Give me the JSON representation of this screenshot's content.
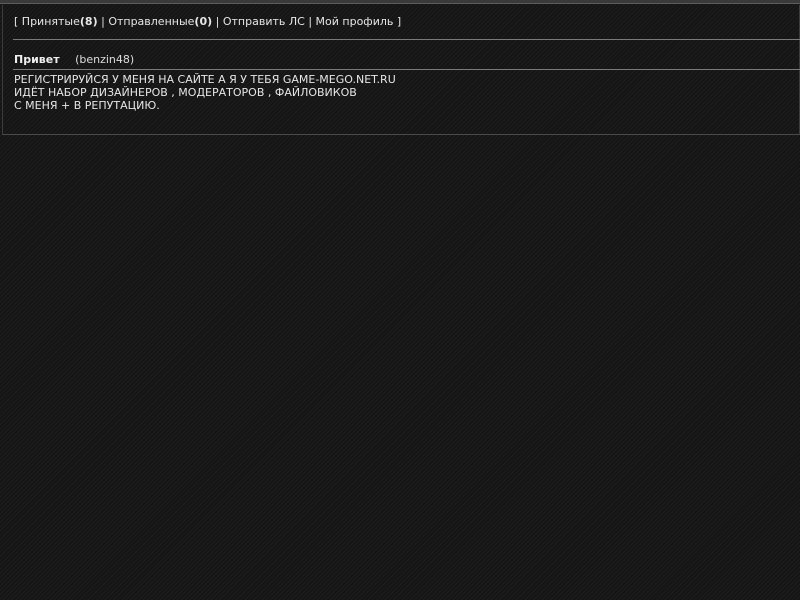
{
  "nav": {
    "open_bracket": "[",
    "received_label": "Принятые",
    "received_count_open": "(",
    "received_count": "8",
    "received_count_close": ")",
    "sep1": "|",
    "sent_label": "Отправленные",
    "sent_count_open": "(",
    "sent_count": "0",
    "sent_count_close": ")",
    "sep2": "|",
    "send_pm_label": "Отправить ЛС",
    "sep3": "|",
    "profile_label": "Мой профиль",
    "close_bracket": "]"
  },
  "message": {
    "subject": "Привет",
    "author": "(benzin48)",
    "lines": [
      "РЕГИСТРИРУЙСЯ У МЕНЯ НА САЙТЕ А Я У ТЕБЯ GAME-MEGO.NET.RU",
      "ИДЁТ НАБОР ДИЗАЙНЕРОВ , МОДЕРАТОРОВ , ФАЙЛОВИКОВ",
      "С МЕНЯ + В РЕПУТАЦИЮ."
    ]
  },
  "colors": {
    "background": "#151515",
    "text": "#e6e6e6",
    "separator": "#7a7a7a"
  }
}
